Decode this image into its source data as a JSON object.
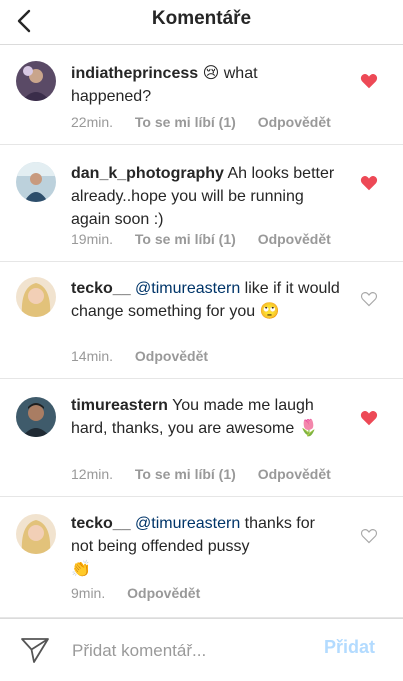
{
  "header": {
    "title": "Komentáře"
  },
  "colors": {
    "liked_heart": "#ed4956",
    "link_blue": "#003569",
    "post_button": "#b3dbff"
  },
  "comments": [
    {
      "username": "indiatheprincess",
      "text": " what happened?",
      "emoji_before": "😢",
      "time": "22min.",
      "likes_label": "To se mi líbí (1)",
      "reply_label": "Odpovědět",
      "liked": true
    },
    {
      "username": "dan_k_photography",
      "text": "Ah looks better already..hope you will be running again soon :)",
      "time": "19min.",
      "likes_label": "To se mi líbí (1)",
      "reply_label": "Odpovědět",
      "liked": true
    },
    {
      "username": "tecko__",
      "mention": "@timureastern",
      "text": "like if it would change something for you",
      "emoji_after": "🙄",
      "time": "14min.",
      "reply_label": "Odpovědět",
      "liked": false
    },
    {
      "username": "timureastern",
      "text": "You made me laugh hard, thanks, you are awesome",
      "emoji_after": "🌷",
      "time": "12min.",
      "likes_label": "To se mi líbí (1)",
      "reply_label": "Odpovědět",
      "liked": true
    },
    {
      "username": "tecko__",
      "mention": "@timureastern",
      "text": "thanks for not being offended pussy",
      "emoji_after": "👏",
      "time": "9min.",
      "reply_label": "Odpovědět",
      "liked": false
    }
  ],
  "footer": {
    "input_placeholder": "Přidat komentář...",
    "post_label": "Přidat"
  }
}
